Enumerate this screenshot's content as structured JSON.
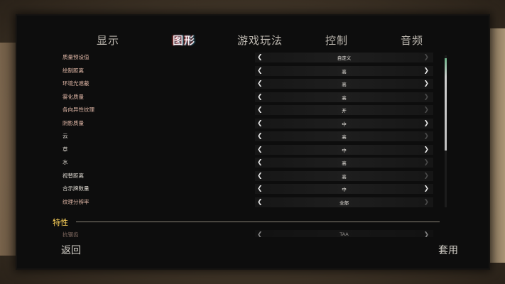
{
  "tabs": [
    {
      "label": "显示"
    },
    {
      "label": "图形"
    },
    {
      "label": "游戏玩法"
    },
    {
      "label": "控制"
    },
    {
      "label": "音频"
    }
  ],
  "active_tab": "图形",
  "settings": [
    {
      "label": "质量预设值",
      "value": "自定义"
    },
    {
      "label": "绘制距离",
      "value": "高"
    },
    {
      "label": "环境光遮蔽",
      "value": "高"
    },
    {
      "label": "雾化质量",
      "value": "高"
    },
    {
      "label": "各向异性纹理",
      "value": "开"
    },
    {
      "label": "阴影质量",
      "value": "中"
    },
    {
      "label": "云",
      "value": "高"
    },
    {
      "label": "草",
      "value": "中"
    },
    {
      "label": "水",
      "value": "高"
    },
    {
      "label": "视替距离",
      "value": "高"
    },
    {
      "label": "合示牌数量",
      "value": "中"
    },
    {
      "label": "纹理分辨率",
      "value": "全部"
    }
  ],
  "section": {
    "title": "特性"
  },
  "partial_setting": {
    "label": "抗锯齿",
    "value": "TAA"
  },
  "footer": {
    "back_label": "返回",
    "apply_label": "套用"
  },
  "colors": {
    "panel": "#0d0d0d",
    "active_tab_text": "#ffffff",
    "label_text": "#e0b7a6",
    "section_title": "#ffd35a"
  },
  "icons": {
    "left": "chevron-left-icon",
    "right": "chevron-right-icon"
  }
}
